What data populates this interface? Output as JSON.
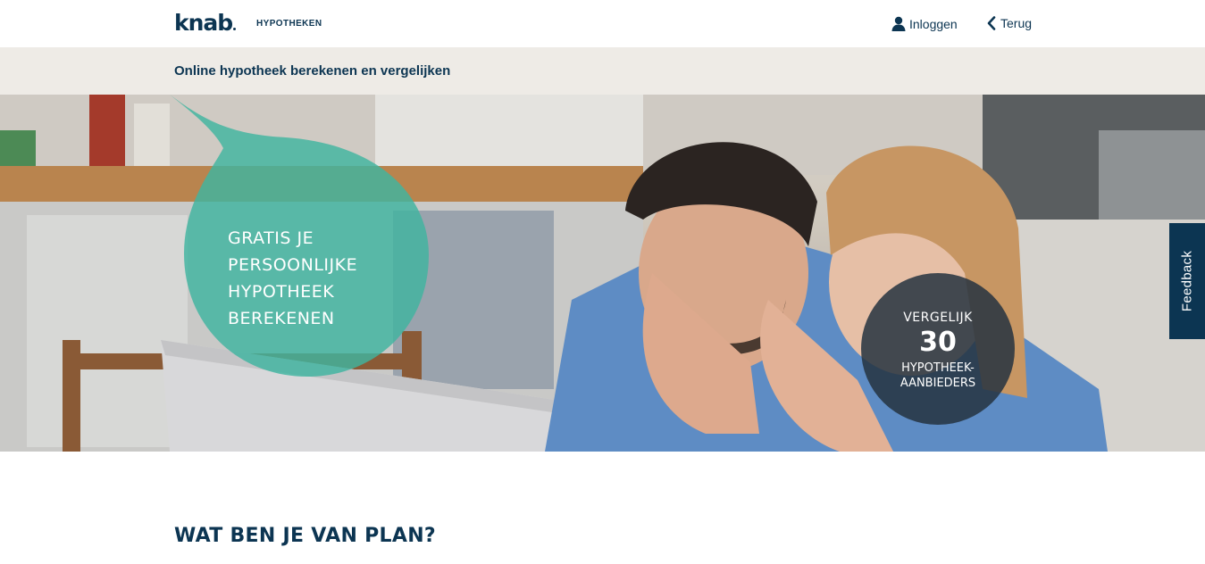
{
  "header": {
    "logo": "knab",
    "product": "HYPOTHEKEN",
    "login_label": "Inloggen",
    "back_label": "Terug",
    "login_icon": "user-icon",
    "back_icon": "chevron-left-icon"
  },
  "subheader": {
    "title": "Online hypotheek berekenen en vergelijken"
  },
  "hero": {
    "bubble_lines": [
      "GRATIS JE",
      "PERSOONLIJKE",
      "HYPOTHEEK",
      "BEREKENEN"
    ],
    "circle": {
      "line1": "VERGELIJK",
      "number": "30",
      "line2": "HYPOTHEEK-",
      "line3": "AANBIEDERS"
    },
    "colors": {
      "bubble": "#3fb5a0",
      "circle": "#243240"
    }
  },
  "feedback": {
    "label": "Feedback"
  },
  "section": {
    "title": "WAT BEN JE VAN PLAN?"
  },
  "colors": {
    "brand_navy": "#0c3552",
    "subbar_bg": "#eeebe6"
  }
}
